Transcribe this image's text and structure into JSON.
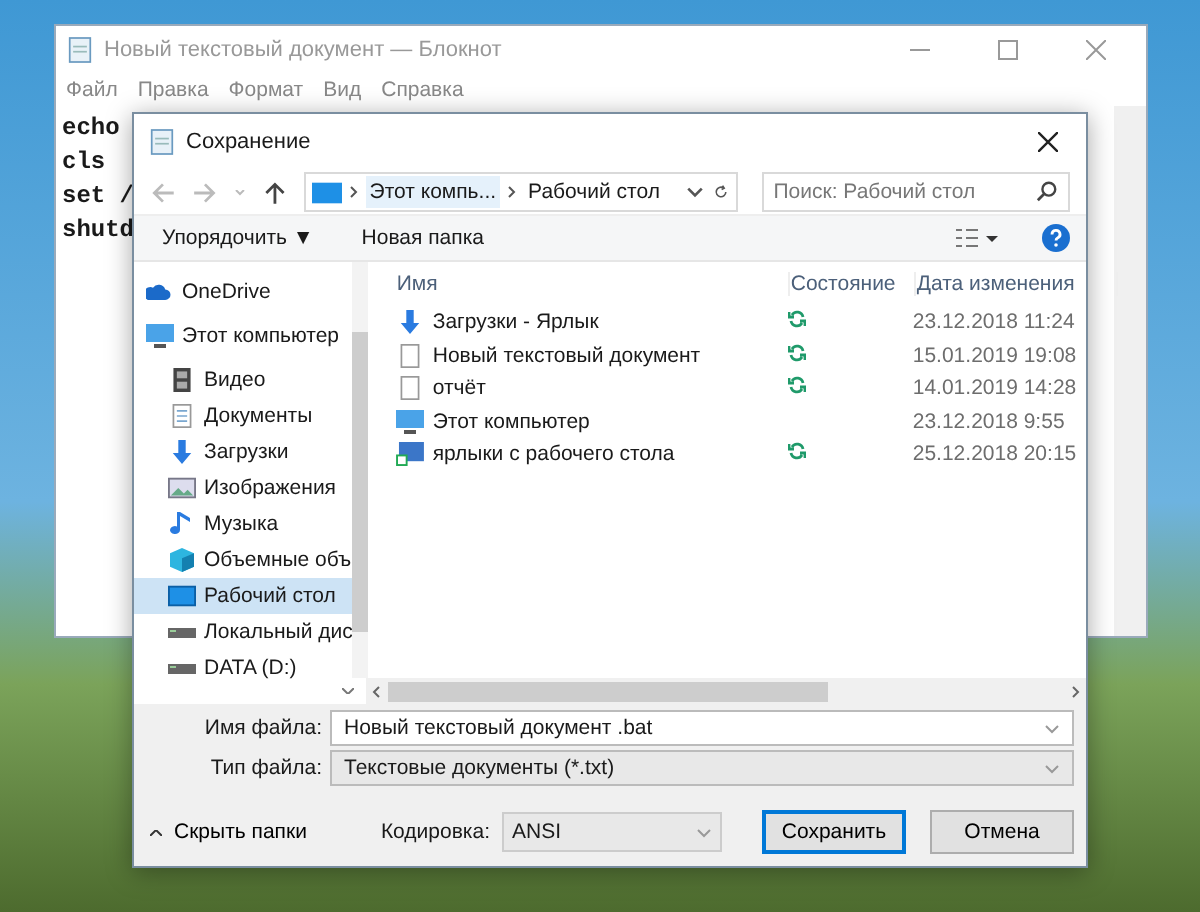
{
  "notepad": {
    "title": "Новый текстовый документ — Блокнот",
    "menu": [
      "Файл",
      "Правка",
      "Формат",
      "Вид",
      "Справка"
    ],
    "lines": [
      "echo",
      "cls",
      "set /",
      "shutd"
    ]
  },
  "dialog": {
    "title": "Сохранение",
    "breadcrumbs": [
      "Этот компь...",
      "Рабочий стол"
    ],
    "search": {
      "placeholder": "Поиск: Рабочий стол"
    },
    "toolbar": {
      "organize": "Упорядочить ▼",
      "new_folder": "Новая папка"
    },
    "nav": [
      {
        "label": "OneDrive",
        "kind": "cloud",
        "selected": false
      },
      {
        "label": "Этот компьютер",
        "kind": "computer",
        "selected": false,
        "children": [
          {
            "label": "Видео",
            "kind": "video",
            "selected": false
          },
          {
            "label": "Документы",
            "kind": "document",
            "selected": false
          },
          {
            "label": "Загрузки",
            "kind": "download",
            "selected": false
          },
          {
            "label": "Изображения",
            "kind": "picture",
            "selected": false
          },
          {
            "label": "Музыка",
            "kind": "music",
            "selected": false
          },
          {
            "label": "Объемные объ",
            "kind": "cube",
            "selected": false
          },
          {
            "label": "Рабочий стол",
            "kind": "desktop",
            "selected": true
          },
          {
            "label": "Локальный дис",
            "kind": "drive",
            "selected": false
          },
          {
            "label": "DATA (D:)",
            "kind": "drive",
            "selected": false
          }
        ]
      }
    ],
    "table": {
      "columns": [
        "Имя",
        "Состояние",
        "Дата изменения"
      ],
      "rows": [
        {
          "name": "Загрузки - Ярлык",
          "kind": "download",
          "synced": true,
          "date": "23.12.2018 11:24"
        },
        {
          "name": "Новый текстовый документ",
          "kind": "document",
          "synced": true,
          "date": "15.01.2019 19:08"
        },
        {
          "name": "отчёт",
          "kind": "document",
          "synced": true,
          "date": "14.01.2019 14:28"
        },
        {
          "name": "Этот компьютер",
          "kind": "computer",
          "synced": false,
          "date": "23.12.2018 9:55"
        },
        {
          "name": "ярлыки с рабочего стола",
          "kind": "shortcut",
          "synced": true,
          "date": "25.12.2018 20:15"
        }
      ]
    },
    "file_name": {
      "label": "Имя файла:",
      "value": "Новый текстовый документ .bat"
    },
    "file_type": {
      "label": "Тип файла:",
      "value": "Текстовые документы (*.txt)"
    },
    "hide_folders": "Скрыть папки",
    "encoding": {
      "label": "Кодировка:",
      "value": "ANSI"
    },
    "buttons": [
      {
        "label": "Сохранить",
        "primary": true
      },
      {
        "label": "Отмена",
        "primary": false
      }
    ]
  }
}
